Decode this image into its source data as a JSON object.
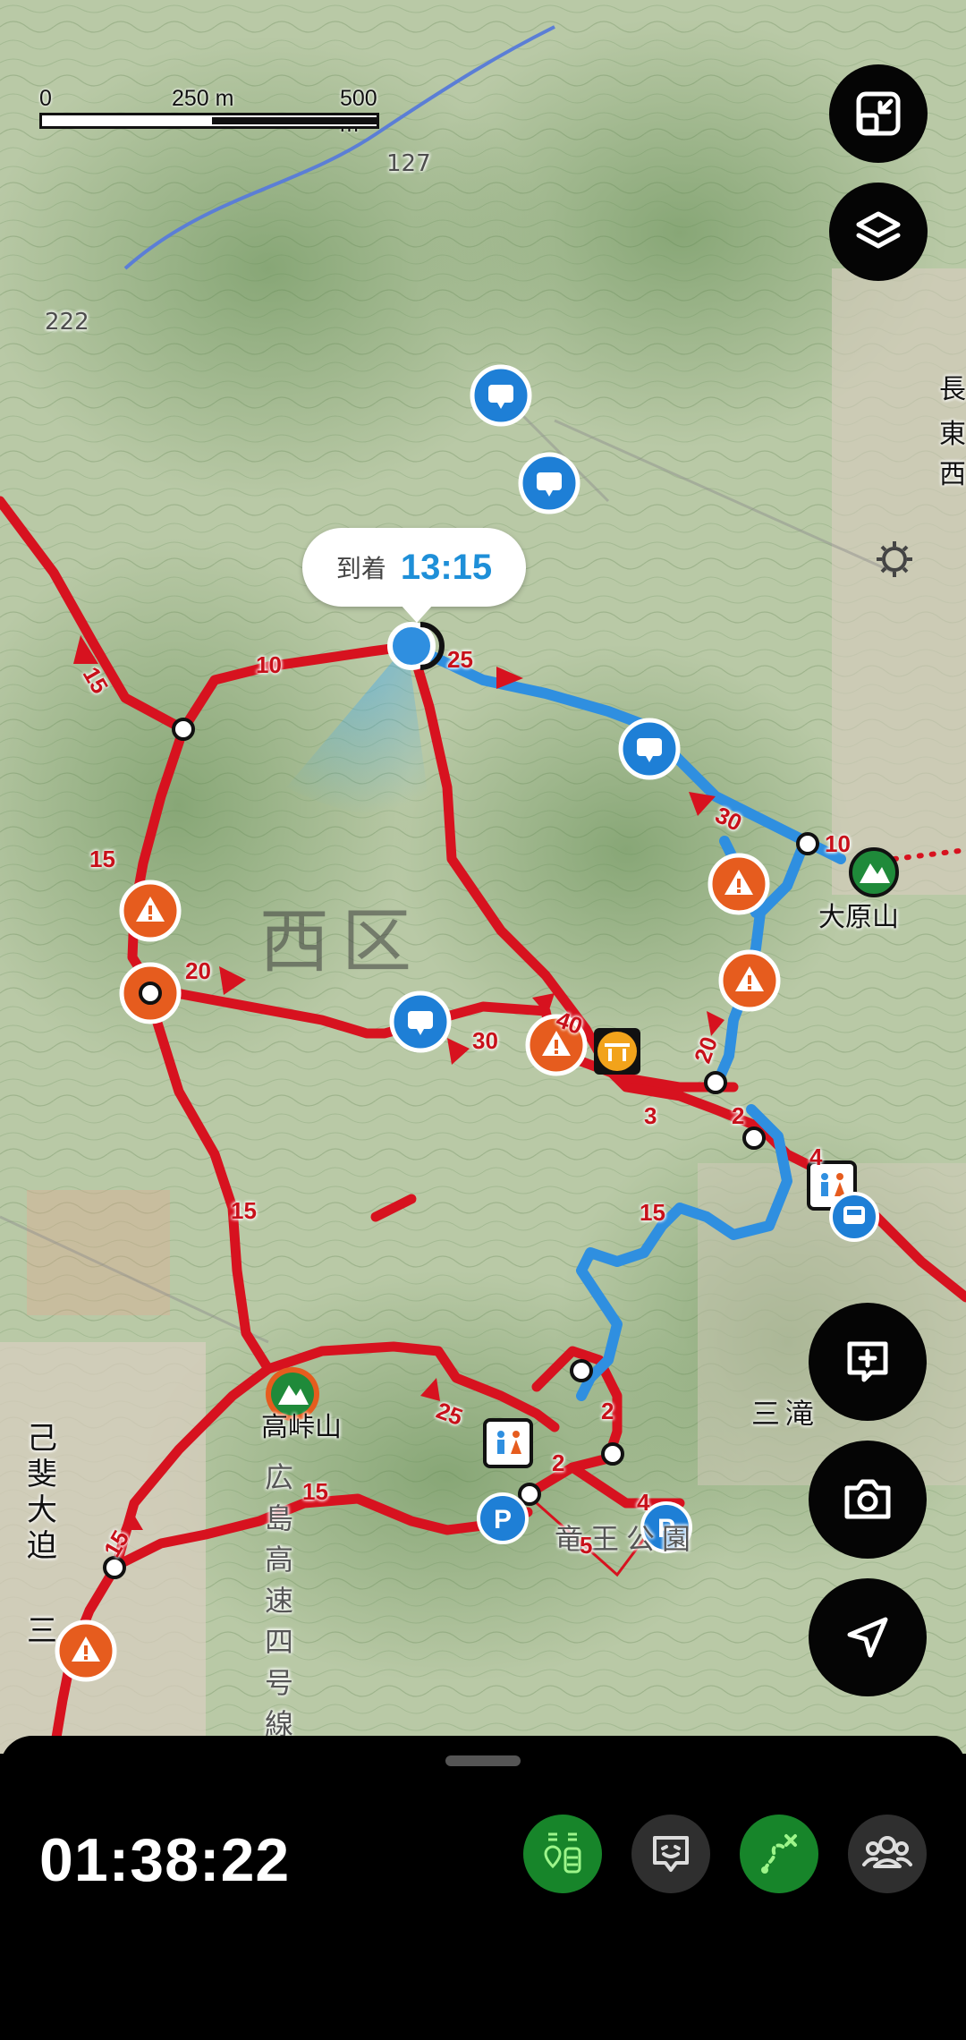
{
  "map": {
    "scale": {
      "zero": "0",
      "mid": "250 m",
      "end": "500 m"
    },
    "eta": {
      "label": "到着",
      "time": "13:15"
    },
    "district_label": "西区",
    "peaks": [
      {
        "name": "大原山"
      },
      {
        "name": "高峠山"
      }
    ],
    "place_labels": [
      "己",
      "斐",
      "大",
      "迫",
      "三",
      "三滝",
      "竜王公園",
      "広島高速四号線",
      "長",
      "東",
      "西",
      "127",
      "222"
    ],
    "distance_labels": [
      "10",
      "25",
      "15",
      "15",
      "20",
      "30",
      "40",
      "30",
      "10",
      "20",
      "3",
      "2",
      "4",
      "15",
      "15",
      "25",
      "2",
      "2",
      "4",
      "5",
      "15",
      "15"
    ]
  },
  "panel": {
    "timer": "01:38:22",
    "buttons": [
      {
        "icon": "route-markers-icon",
        "active": true
      },
      {
        "icon": "chat-face-icon",
        "active": false
      },
      {
        "icon": "route-off-icon",
        "active": true
      },
      {
        "icon": "group-icon",
        "active": false
      }
    ]
  },
  "colors": {
    "route_red": "#d7121f",
    "route_blue": "#2f8fe0",
    "warning_orange": "#e65c1e",
    "peak_green": "#1f8a3a",
    "active_button": "#17852a"
  }
}
